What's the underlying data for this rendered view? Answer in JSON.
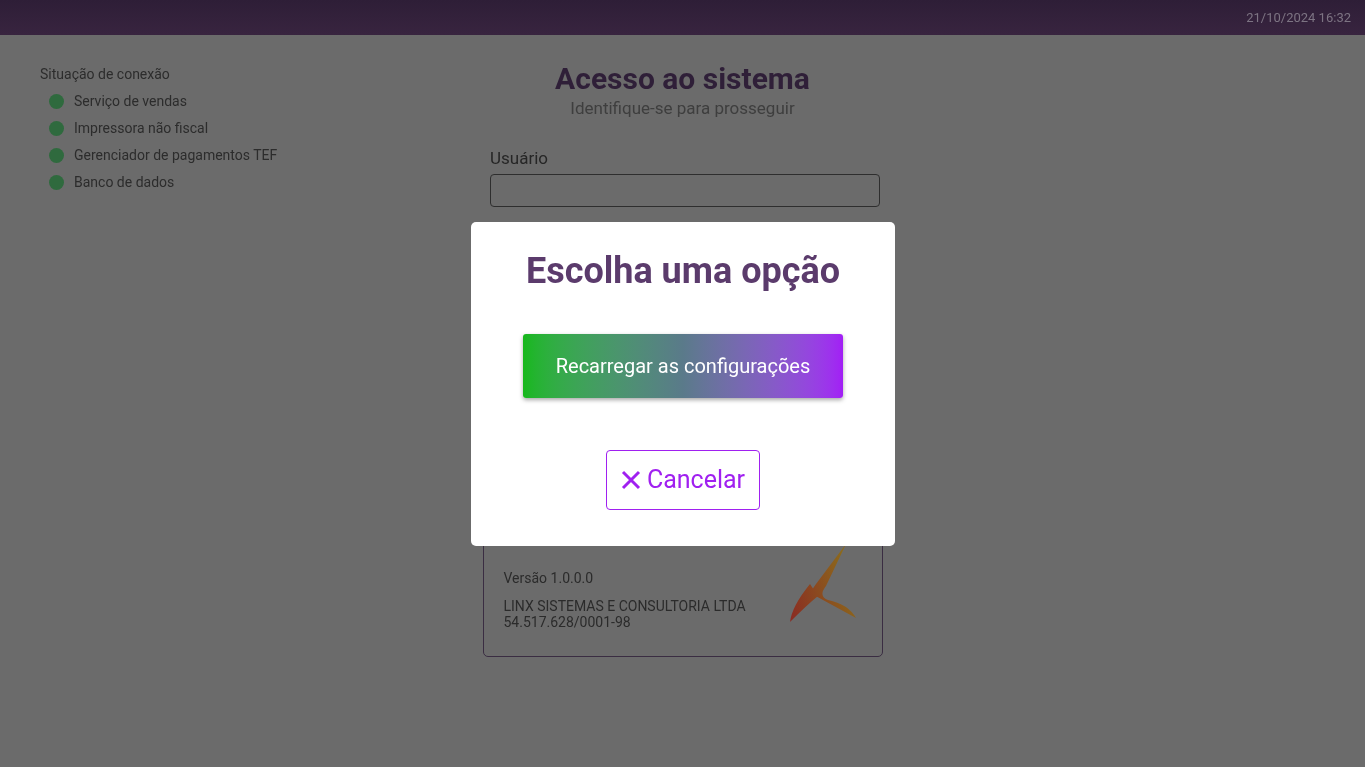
{
  "top_bar": {
    "datetime": "21/10/2024 16:32"
  },
  "connection_status": {
    "title": "Situação de conexão",
    "items": [
      {
        "label": "Serviço de vendas",
        "color": "#2f6a3e"
      },
      {
        "label": "Impressora não fiscal",
        "color": "#2f6a3e"
      },
      {
        "label": "Gerenciador de pagamentos TEF",
        "color": "#2f6a3e"
      },
      {
        "label": "Banco de dados",
        "color": "#2f6a3e"
      }
    ]
  },
  "login": {
    "title": "Acesso ao sistema",
    "subtitle": "Identifique-se para prosseguir",
    "user_label": "Usuário"
  },
  "about_card": {
    "version": "Versão 1.0.0.0",
    "company": "LINX SISTEMAS E CONSULTORIA LTDA",
    "cnpj": "54.517.628/0001-98"
  },
  "dialog": {
    "title": "Escolha uma opção",
    "primary_button": "Recarregar as configurações",
    "cancel_button": "Cancelar"
  }
}
